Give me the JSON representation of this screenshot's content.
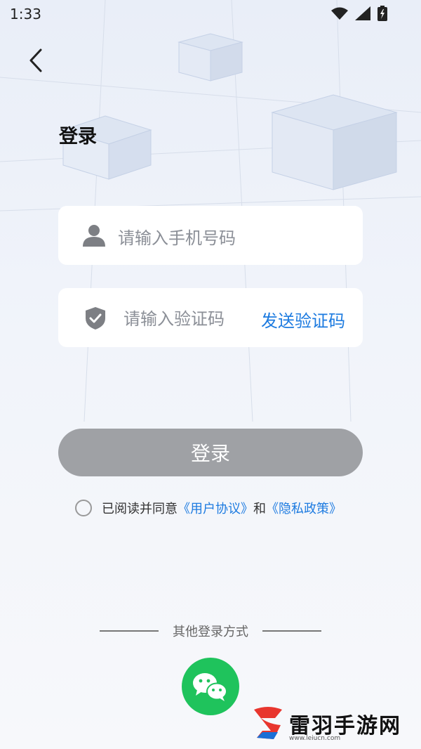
{
  "status_bar": {
    "time": "1:33"
  },
  "header": {
    "title": "登录"
  },
  "form": {
    "phone_placeholder": "请输入手机号码",
    "code_placeholder": "请输入验证码",
    "send_code_label": "发送验证码"
  },
  "login_button_label": "登录",
  "agreement": {
    "text": "已阅读并同意",
    "user_agreement": "《用户协议》",
    "and": "和",
    "privacy_policy": "《隐私政策》"
  },
  "other_login": {
    "label": "其他登录方式"
  },
  "watermark": {
    "text": "雷羽手游网",
    "url": "www.leiucn.com"
  },
  "colors": {
    "accent": "#1d7be0",
    "button_disabled": "#9fa1a5",
    "wechat": "#1fc35c"
  }
}
